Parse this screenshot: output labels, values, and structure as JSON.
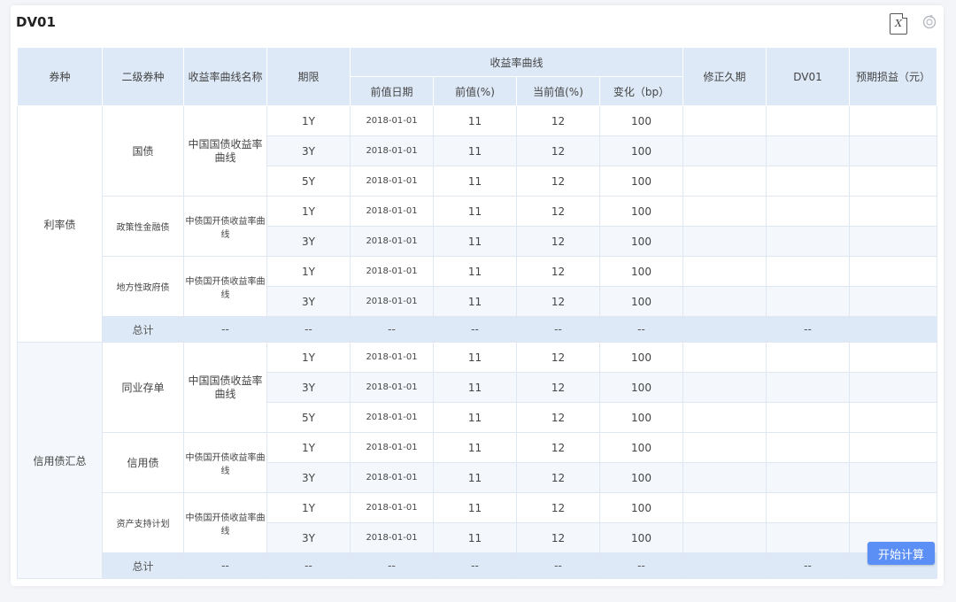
{
  "page": {
    "title": "DV01",
    "excel_icon_glyph": "X",
    "calc_button": "开始计算",
    "colors": {
      "header_bg": "#dde9f7",
      "accent": "#5b8ff5"
    }
  },
  "headers": {
    "bond_type": "券种",
    "sub_type": "二级券种",
    "curve_name": "收益率曲线名称",
    "yield_curve": "收益率曲线",
    "term": "期限",
    "prev_date": "前值日期",
    "prev_value": "前值(%)",
    "curr_value": "当前值(%)",
    "change": "变化（bp）",
    "mod_duration": "修正久期",
    "dv01": "DV01",
    "expected_pl": "预期损益（元）"
  },
  "groups": [
    {
      "name": "利率债",
      "subs": [
        {
          "name": "国债",
          "curve": "中国国债收益率曲线",
          "rows": [
            {
              "term": "1Y",
              "date": "2018-01-01",
              "prev": "11",
              "curr": "12",
              "chg": "100"
            },
            {
              "term": "3Y",
              "date": "2018-01-01",
              "prev": "11",
              "curr": "12",
              "chg": "100"
            },
            {
              "term": "5Y",
              "date": "2018-01-01",
              "prev": "11",
              "curr": "12",
              "chg": "100"
            }
          ]
        },
        {
          "name": "政策性金融债",
          "curve": "中债国开债收益率曲线",
          "rows": [
            {
              "term": "1Y",
              "date": "2018-01-01",
              "prev": "11",
              "curr": "12",
              "chg": "100"
            },
            {
              "term": "3Y",
              "date": "2018-01-01",
              "prev": "11",
              "curr": "12",
              "chg": "100"
            }
          ]
        },
        {
          "name": "地方性政府债",
          "curve": "中债国开债收益率曲线",
          "rows": [
            {
              "term": "1Y",
              "date": "2018-01-01",
              "prev": "11",
              "curr": "12",
              "chg": "100"
            },
            {
              "term": "3Y",
              "date": "2018-01-01",
              "prev": "11",
              "curr": "12",
              "chg": "100"
            }
          ]
        }
      ],
      "total": {
        "label": "总计",
        "dash": "--"
      }
    },
    {
      "name": "信用债汇总",
      "subs": [
        {
          "name": "同业存单",
          "curve": "中国国债收益率曲线",
          "rows": [
            {
              "term": "1Y",
              "date": "2018-01-01",
              "prev": "11",
              "curr": "12",
              "chg": "100"
            },
            {
              "term": "3Y",
              "date": "2018-01-01",
              "prev": "11",
              "curr": "12",
              "chg": "100"
            },
            {
              "term": "5Y",
              "date": "2018-01-01",
              "prev": "11",
              "curr": "12",
              "chg": "100"
            }
          ]
        },
        {
          "name": "信用债",
          "curve": "中债国开债收益率曲线",
          "rows": [
            {
              "term": "1Y",
              "date": "2018-01-01",
              "prev": "11",
              "curr": "12",
              "chg": "100"
            },
            {
              "term": "3Y",
              "date": "2018-01-01",
              "prev": "11",
              "curr": "12",
              "chg": "100"
            }
          ]
        },
        {
          "name": "资产支持计划",
          "curve": "中债国开债收益率曲线",
          "rows": [
            {
              "term": "1Y",
              "date": "2018-01-01",
              "prev": "11",
              "curr": "12",
              "chg": "100"
            },
            {
              "term": "3Y",
              "date": "2018-01-01",
              "prev": "11",
              "curr": "12",
              "chg": "100"
            }
          ]
        }
      ],
      "total": {
        "label": "总计",
        "dash": "--"
      }
    }
  ]
}
